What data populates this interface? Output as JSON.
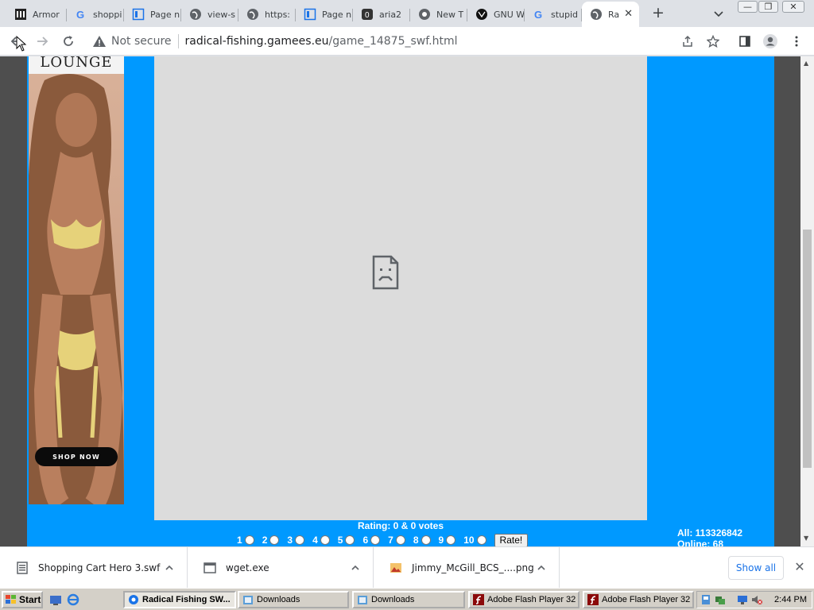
{
  "browser": {
    "tabs": [
      {
        "label": "Armor",
        "icon": "museum-icon"
      },
      {
        "label": "shoppi",
        "icon": "google-icon"
      },
      {
        "label": "Page n",
        "icon": "page-icon"
      },
      {
        "label": "view-s",
        "icon": "globe-icon"
      },
      {
        "label": "https:",
        "icon": "globe-icon"
      },
      {
        "label": "Page n",
        "icon": "page-icon"
      },
      {
        "label": "aria2",
        "icon": "zero-icon"
      },
      {
        "label": "New T",
        "icon": "chrome-icon"
      },
      {
        "label": "GNU W",
        "icon": "gnu-icon"
      },
      {
        "label": "stupid",
        "icon": "google-icon"
      },
      {
        "label": "Ra",
        "icon": "globe-icon",
        "active": true
      }
    ],
    "close_tab": "✕",
    "new_tab": "+",
    "minimize": "—",
    "restore": "❐",
    "close_window": "✕",
    "address": {
      "security_label": "Not secure",
      "host": "radical-fishing.gamees.eu",
      "path": "/game_14875_swf.html"
    }
  },
  "page": {
    "ad_brand": "LOUNGE",
    "ad_button": "SHOP NOW",
    "rating_text": "Rating: 0 & 0 votes",
    "rating_options": [
      "1",
      "2",
      "3",
      "4",
      "5",
      "6",
      "7",
      "8",
      "9",
      "10"
    ],
    "rate_button": "Rate!",
    "stats_all": "All: 113326842",
    "stats_online": "Online: 68"
  },
  "downloads": {
    "items": [
      {
        "name": "Shopping Cart Hero 3.swf"
      },
      {
        "name": "wget.exe"
      },
      {
        "name": "Jimmy_McGill_BCS_....png"
      }
    ],
    "show_all": "Show all"
  },
  "taskbar": {
    "start": "Start",
    "tasks": [
      {
        "label": "Radical Fishing SW...",
        "active": true
      },
      {
        "label": "Downloads"
      },
      {
        "label": "Downloads"
      },
      {
        "label": "Adobe Flash Player 32"
      },
      {
        "label": "Adobe Flash Player 32"
      }
    ],
    "clock": "2:44 PM"
  },
  "colors": {
    "site_blue": "#0099ff",
    "game_bg": "#dcdcdc",
    "link_blue": "#1a73e8"
  }
}
